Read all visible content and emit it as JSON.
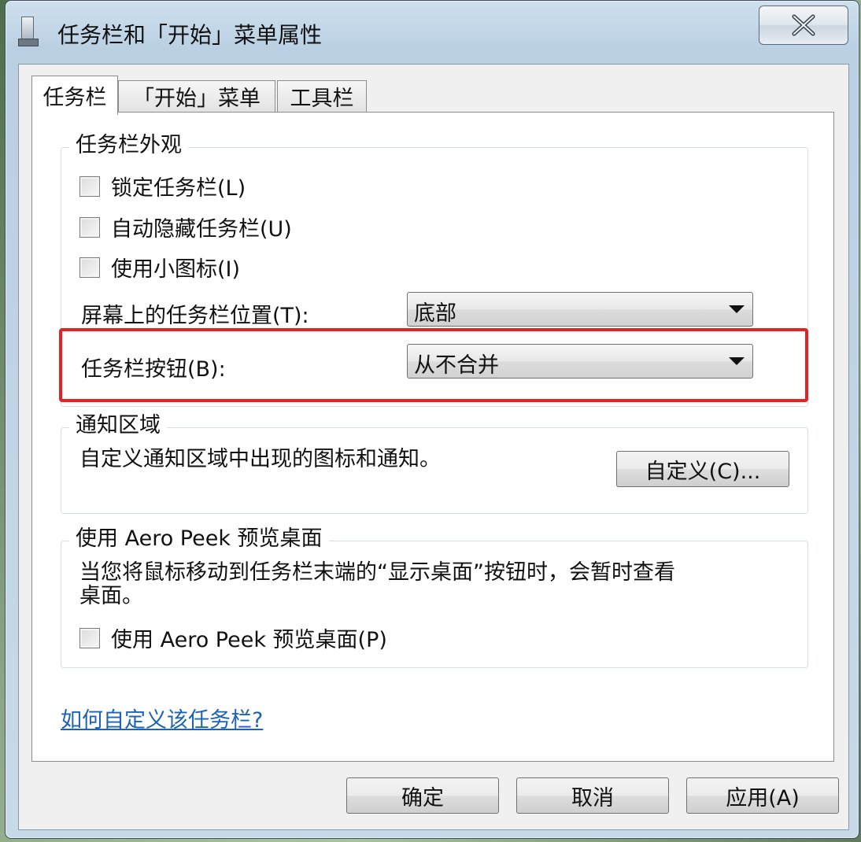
{
  "window": {
    "title": "任务栏和「开始」菜单属性",
    "close_glyph": "✕"
  },
  "tabs": [
    {
      "label": "任务栏",
      "active": true
    },
    {
      "label": "「开始」菜单",
      "active": false
    },
    {
      "label": "工具栏",
      "active": false
    }
  ],
  "appearance": {
    "group_label": "任务栏外观",
    "lock_label": "锁定任务栏(L)",
    "autohide_label": "自动隐藏任务栏(U)",
    "small_icons_label": "使用小图标(I)",
    "position_label": "屏幕上的任务栏位置(T):",
    "position_value": "底部",
    "buttons_label": "任务栏按钮(B):",
    "buttons_value": "从不合并"
  },
  "notification": {
    "group_label": "通知区域",
    "desc": "自定义通知区域中出现的图标和通知。",
    "customize_button": "自定义(C)..."
  },
  "peek": {
    "group_label": "使用 Aero Peek 预览桌面",
    "desc_line1": "当您将鼠标移动到任务栏末端的“显示桌面”按钮时，会暂时查看",
    "desc_line2": "桌面。",
    "checkbox_label": "使用 Aero Peek 预览桌面(P)"
  },
  "help_link": "如何自定义该任务栏?",
  "footer": {
    "ok": "确定",
    "cancel": "取消",
    "apply": "应用(A)"
  },
  "colors": {
    "highlight": "#e52222",
    "link": "#1c63b8"
  }
}
